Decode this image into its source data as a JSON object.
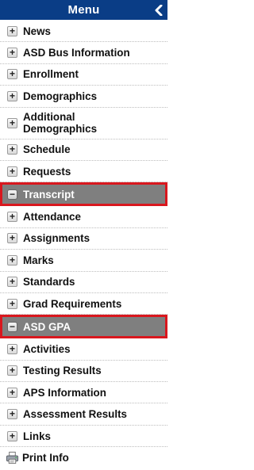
{
  "menu": {
    "title": "Menu",
    "collapse_glyph": "❮",
    "items": [
      {
        "label": "News",
        "marker": "+",
        "state": "collapsed"
      },
      {
        "label": "ASD Bus Information",
        "marker": "+",
        "state": "collapsed"
      },
      {
        "label": "Enrollment",
        "marker": "+",
        "state": "collapsed"
      },
      {
        "label": "Demographics",
        "marker": "+",
        "state": "collapsed"
      },
      {
        "label": "Additional Demographics",
        "marker": "+",
        "state": "collapsed"
      },
      {
        "label": "Schedule",
        "marker": "+",
        "state": "collapsed"
      },
      {
        "label": "Requests",
        "marker": "+",
        "state": "collapsed"
      },
      {
        "label": "Transcript",
        "marker": "−",
        "state": "expanded-highlighted"
      },
      {
        "label": "Attendance",
        "marker": "+",
        "state": "collapsed"
      },
      {
        "label": "Assignments",
        "marker": "+",
        "state": "collapsed"
      },
      {
        "label": "Marks",
        "marker": "+",
        "state": "collapsed"
      },
      {
        "label": "Standards",
        "marker": "+",
        "state": "collapsed"
      },
      {
        "label": "Grad Requirements",
        "marker": "+",
        "state": "collapsed"
      },
      {
        "label": "ASD GPA",
        "marker": "−",
        "state": "expanded-highlighted"
      },
      {
        "label": "Activities",
        "marker": "+",
        "state": "collapsed"
      },
      {
        "label": "Testing Results",
        "marker": "+",
        "state": "collapsed"
      },
      {
        "label": "APS Information",
        "marker": "+",
        "state": "collapsed"
      },
      {
        "label": "Assessment Results",
        "marker": "+",
        "state": "collapsed"
      },
      {
        "label": "Links",
        "marker": "+",
        "state": "collapsed"
      },
      {
        "label": "Print Info",
        "icon": "printer-icon",
        "state": "action"
      }
    ]
  },
  "colors": {
    "header_bg": "#0a3d86",
    "selected_bg": "#7f7f7f",
    "highlight_border": "#d9171e"
  }
}
